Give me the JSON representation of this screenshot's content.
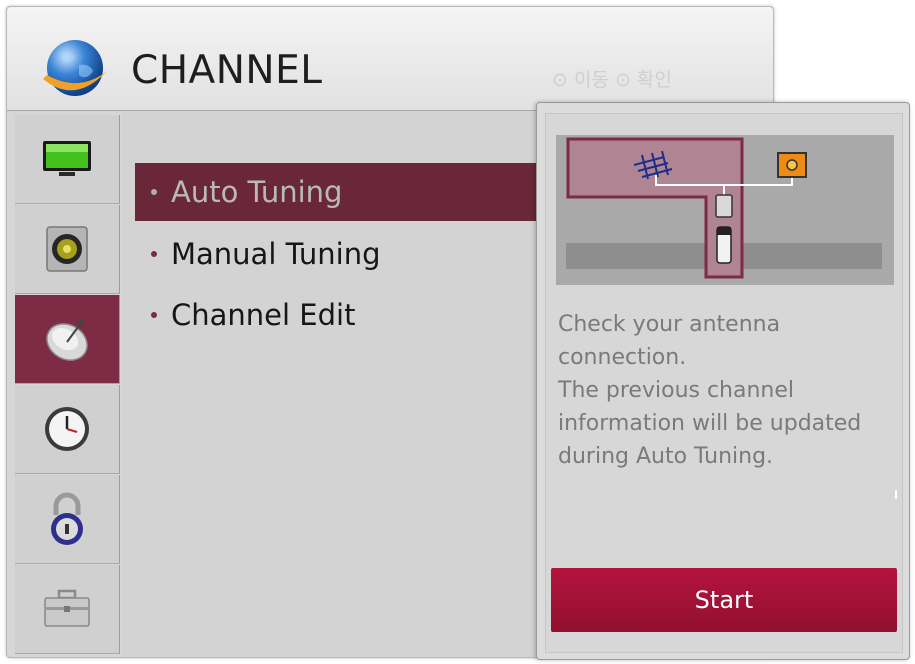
{
  "header": {
    "title": "CHANNEL",
    "hint_text": "⊙ 이동   ⊙ 확인"
  },
  "sidebar": {
    "tabs": [
      {
        "name": "picture",
        "icon": "tv-icon"
      },
      {
        "name": "audio",
        "icon": "speaker-icon"
      },
      {
        "name": "channel",
        "icon": "satellite-dish-icon",
        "active": true
      },
      {
        "name": "time",
        "icon": "clock-icon"
      },
      {
        "name": "lock",
        "icon": "padlock-icon"
      },
      {
        "name": "option",
        "icon": "toolbox-icon"
      }
    ]
  },
  "menu": {
    "items": [
      {
        "label": "Auto Tuning",
        "selected": true
      },
      {
        "label": "Manual Tuning",
        "selected": false
      },
      {
        "label": "Channel Edit",
        "selected": false
      }
    ]
  },
  "popup": {
    "description_lines": [
      "Check your antenna",
      "connection.",
      "The previous channel",
      "information will be updated",
      "during Auto Tuning."
    ],
    "start_label": "Start"
  },
  "colors": {
    "accent": "#7e2c46",
    "selected_row": "#6a2739",
    "start_button": "#a4123a"
  }
}
